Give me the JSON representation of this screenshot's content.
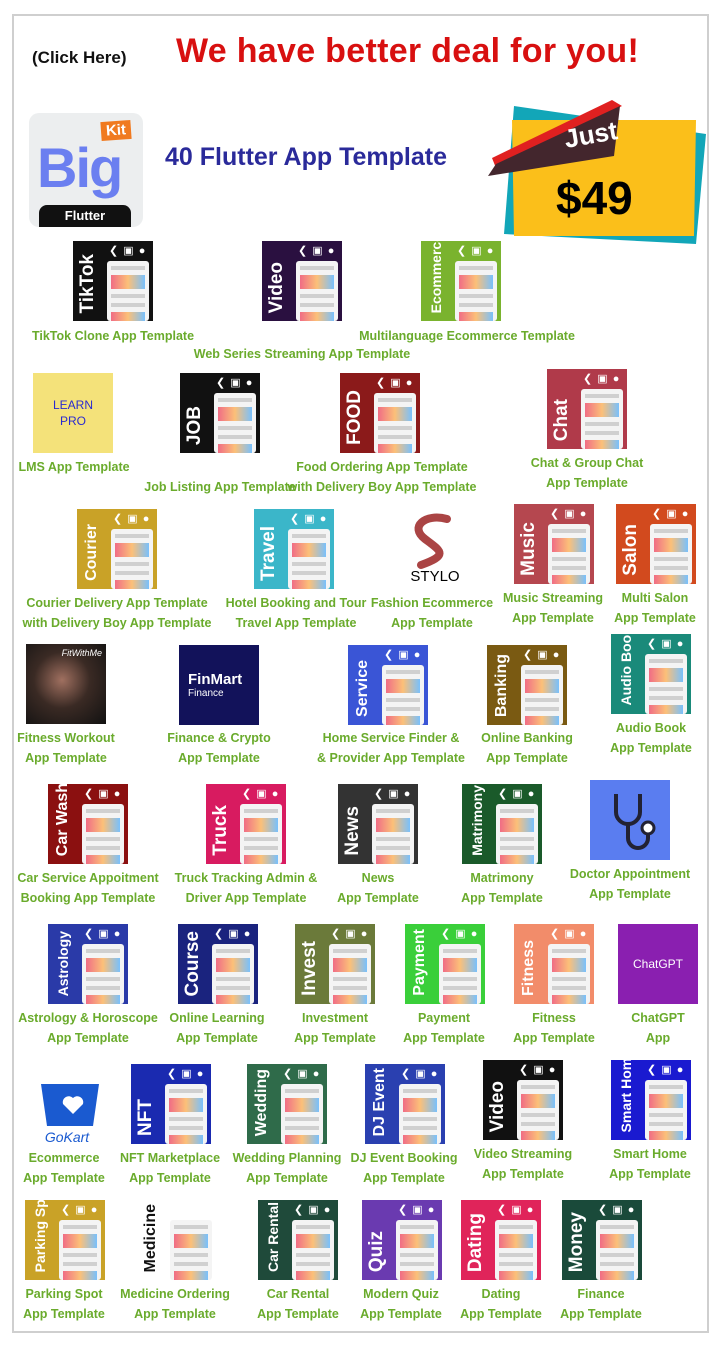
{
  "header": {
    "click_label": "(Click Here)",
    "headline": "We have better deal for you!",
    "subhead": "40 Flutter App Template"
  },
  "logo": {
    "big": "Big",
    "kit": "Kit",
    "flutter": "Flutter"
  },
  "price_badge": {
    "just": "Just",
    "price": "$49"
  },
  "colors": {
    "headline": "#d81010",
    "subhead": "#2a2a9a",
    "caption": "#6aab2c",
    "badge_yellow": "#fbbf1a",
    "badge_teal": "#12a6b8",
    "badge_ribbon": "#43262d"
  },
  "platform_icons": [
    "flutter-icon",
    "android-icon",
    "apple-icon"
  ],
  "templates": [
    {
      "tile": "TikTok",
      "bg": "#111111",
      "caption": [
        "TikTok Clone App Template"
      ]
    },
    {
      "tile": "Video",
      "bg": "#2a1040",
      "caption": [
        "Web Series Streaming App Template"
      ]
    },
    {
      "tile": "Ecommerce",
      "bg": "#7ab32e",
      "caption": [
        "Multilanguage Ecommerce Template"
      ]
    },
    {
      "tile": "LEARN PRO",
      "bg": "#f4e27a",
      "caption": [
        "LMS App Template"
      ]
    },
    {
      "tile": "JOB",
      "bg": "#111111",
      "caption": [
        "Job Listing App Template"
      ]
    },
    {
      "tile": "FOOD",
      "bg": "#8b1a1a",
      "caption": [
        "Food Ordering App Template",
        "with Delivery Boy App Template"
      ]
    },
    {
      "tile": "Chat",
      "bg": "#b03a4a",
      "caption": [
        "Chat & Group Chat",
        "App Template"
      ]
    },
    {
      "tile": "Courier",
      "bg": "#c9a227",
      "caption": [
        "Courier Delivery App Template",
        "with Delivery Boy App Template"
      ]
    },
    {
      "tile": "Travel",
      "bg": "#3bb6c9",
      "caption": [
        "Hotel Booking and Tour",
        "Travel App Template"
      ]
    },
    {
      "tile": "STYLO",
      "bg": "#ffffff",
      "caption": [
        "Fashion Ecommerce",
        "App Template"
      ]
    },
    {
      "tile": "Music",
      "bg": "#b5474f",
      "caption": [
        "Music Streaming",
        "App Template"
      ]
    },
    {
      "tile": "Salon",
      "bg": "#d24a1e",
      "caption": [
        "Multi Salon",
        "App Template"
      ]
    },
    {
      "tile": "FitWithMe",
      "bg": "#2a2624",
      "caption": [
        "Fitness Workout",
        "App Template"
      ]
    },
    {
      "tile": "FinMart",
      "sub": "Finance",
      "bg": "#12125a",
      "caption": [
        "Finance & Crypto",
        "App Template"
      ]
    },
    {
      "tile": "Service",
      "bg": "#3a55d6",
      "caption": [
        "Home Service Finder &",
        "& Provider App Template"
      ]
    },
    {
      "tile": "Banking",
      "bg": "#7a5a12",
      "caption": [
        "Online Banking",
        "App Template"
      ]
    },
    {
      "tile": "Audio Book",
      "bg": "#1a8a7a",
      "caption": [
        "Audio Book",
        "App Template"
      ]
    },
    {
      "tile": "Car Wash",
      "bg": "#8b1010",
      "caption": [
        "Car Service Appoitment",
        "Booking App Template"
      ]
    },
    {
      "tile": "Truck",
      "bg": "#d81b60",
      "caption": [
        "Truck Tracking Admin &",
        "Driver App Template"
      ]
    },
    {
      "tile": "News",
      "bg": "#333333",
      "caption": [
        "News",
        "App Template"
      ]
    },
    {
      "tile": "Matrimony",
      "bg": "#1a5a2a",
      "caption": [
        "Matrimony",
        "App Template"
      ]
    },
    {
      "tile": "",
      "bg": "#5a7df0",
      "icon": "stethoscope-icon",
      "caption": [
        "Doctor Appointment",
        "App Template"
      ]
    },
    {
      "tile": "Astrology",
      "bg": "#2a3aa8",
      "caption": [
        "Astrology & Horoscope",
        "App Template"
      ]
    },
    {
      "tile": "Course",
      "bg": "#1a237e",
      "caption": [
        "Online Learning",
        "App Template"
      ]
    },
    {
      "tile": "Invest",
      "bg": "#6b7a3a",
      "caption": [
        "Investment",
        "App Template"
      ]
    },
    {
      "tile": "Payment",
      "bg": "#3acf3a",
      "caption": [
        "Payment",
        "App Template"
      ]
    },
    {
      "tile": "Fitness",
      "bg": "#f28c6a",
      "caption": [
        "Fitness",
        "App Template"
      ]
    },
    {
      "tile": "ChatGPT",
      "bg": "#8a1fb0",
      "caption": [
        "ChatGPT",
        "App"
      ]
    },
    {
      "tile": "GoKart",
      "bg": "#ffffff",
      "caption": [
        "Ecommerce",
        "App Template"
      ]
    },
    {
      "tile": "NFT",
      "bg": "#1a2ab0",
      "caption": [
        "NFT Marketplace",
        "App Template"
      ]
    },
    {
      "tile": "Wedding",
      "bg": "#2f6b4a",
      "caption": [
        "Wedding Planning",
        "App Template"
      ]
    },
    {
      "tile": "DJ Event",
      "bg": "#2a40b0",
      "caption": [
        "DJ Event Booking",
        "App Template"
      ]
    },
    {
      "tile": "Video",
      "bg": "#111111",
      "caption": [
        "Video Streaming",
        "App Template"
      ]
    },
    {
      "tile": "Smart Home",
      "bg": "#1a1ad0",
      "caption": [
        "Smart Home",
        "App Template"
      ]
    },
    {
      "tile": "Parking Spot",
      "bg": "#c9a227",
      "caption": [
        "Parking Spot",
        "App Template"
      ]
    },
    {
      "tile": "Medicine",
      "bg": "#ffffff",
      "caption": [
        "Medicine Ordering",
        "App Template"
      ]
    },
    {
      "tile": "Car Rental",
      "bg": "#1f4a3a",
      "caption": [
        "Car Rental",
        "App Template"
      ]
    },
    {
      "tile": "Quiz",
      "bg": "#6a3ab0",
      "caption": [
        "Modern Quiz",
        "App Template"
      ]
    },
    {
      "tile": "Dating",
      "bg": "#e0245a",
      "caption": [
        "Dating",
        "App Template"
      ]
    },
    {
      "tile": "Money",
      "bg": "#1a4a3a",
      "caption": [
        "Finance",
        "App Template"
      ]
    }
  ]
}
